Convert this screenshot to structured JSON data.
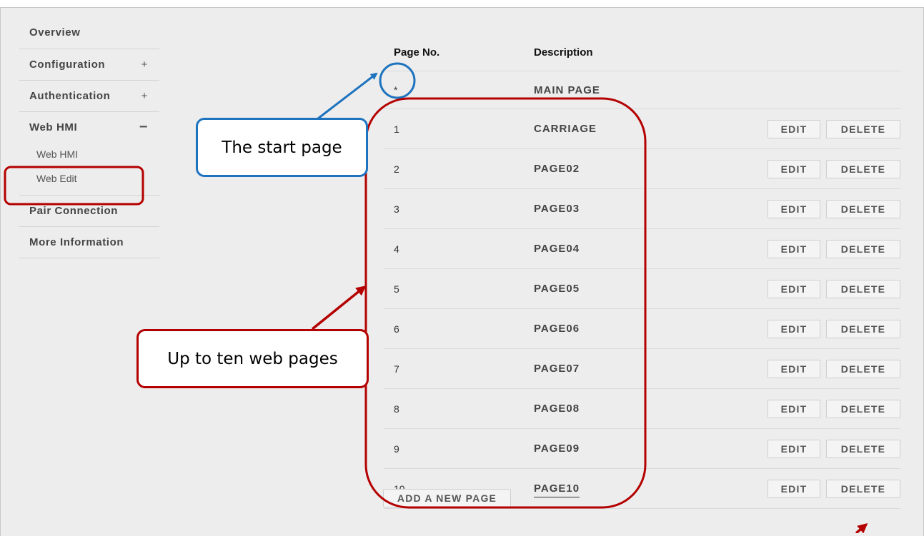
{
  "sidebar": {
    "items": [
      {
        "label": "Overview",
        "toggle": ""
      },
      {
        "label": "Configuration",
        "toggle": "+"
      },
      {
        "label": "Authentication",
        "toggle": "+"
      },
      {
        "label": "Web HMI",
        "toggle": "−"
      },
      {
        "label": "Pair Connection",
        "toggle": ""
      },
      {
        "label": "More Information",
        "toggle": ""
      }
    ],
    "sub_items": [
      "Web HMI",
      "Web Edit"
    ]
  },
  "table": {
    "headers": {
      "page_no": "Page No.",
      "description": "Description"
    },
    "rows": [
      {
        "no": "*",
        "desc": "MAIN PAGE"
      },
      {
        "no": "1",
        "desc": "CARRIAGE"
      },
      {
        "no": "2",
        "desc": "PAGE02"
      },
      {
        "no": "3",
        "desc": "PAGE03"
      },
      {
        "no": "4",
        "desc": "PAGE04"
      },
      {
        "no": "5",
        "desc": "PAGE05"
      },
      {
        "no": "6",
        "desc": "PAGE06"
      },
      {
        "no": "7",
        "desc": "PAGE07"
      },
      {
        "no": "8",
        "desc": "PAGE08"
      },
      {
        "no": "9",
        "desc": "PAGE09"
      },
      {
        "no": "10",
        "desc": "PAGE10"
      }
    ],
    "edit_label": "EDIT",
    "delete_label": "DELETE",
    "add_label": "ADD A NEW PAGE"
  },
  "annotations": {
    "start_page": "The start page",
    "ten_pages": "Up to ten web pages"
  },
  "colors": {
    "annotation_blue": "#1e73be",
    "annotation_red": "#b40000",
    "background": "#ededed"
  }
}
